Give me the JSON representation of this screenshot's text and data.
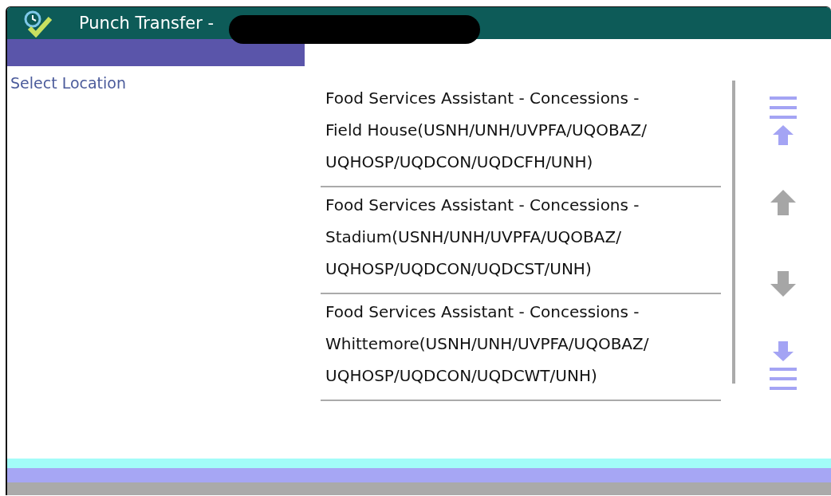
{
  "window": {
    "title": "Punch Transfer -"
  },
  "sidebar": {
    "heading": "Select Location"
  },
  "locations": [
    {
      "text": "Food Services Assistant - Concessions - Field House(USNH/UNH/UVPFA/UQOBAZ/ UQHOSP/UQDCON/UQDCFH/UNH)",
      "selected": false
    },
    {
      "text": "Food Services Assistant - Concessions - Stadium(USNH/UNH/UVPFA/UQOBAZ/ UQHOSP/UQDCON/UQDCST/UNH)",
      "selected": false
    },
    {
      "text": "Food Services Assistant - Concessions - Whittemore(USNH/UNH/UVPFA/UQOBAZ/ UQHOSP/UQDCON/UQDCWT/UNH)",
      "selected": false
    }
  ],
  "scroll_buttons": [
    {
      "kind": "top",
      "disabled": false
    },
    {
      "kind": "up",
      "disabled": true
    },
    {
      "kind": "down",
      "disabled": true
    },
    {
      "kind": "bottom",
      "disabled": false
    }
  ]
}
